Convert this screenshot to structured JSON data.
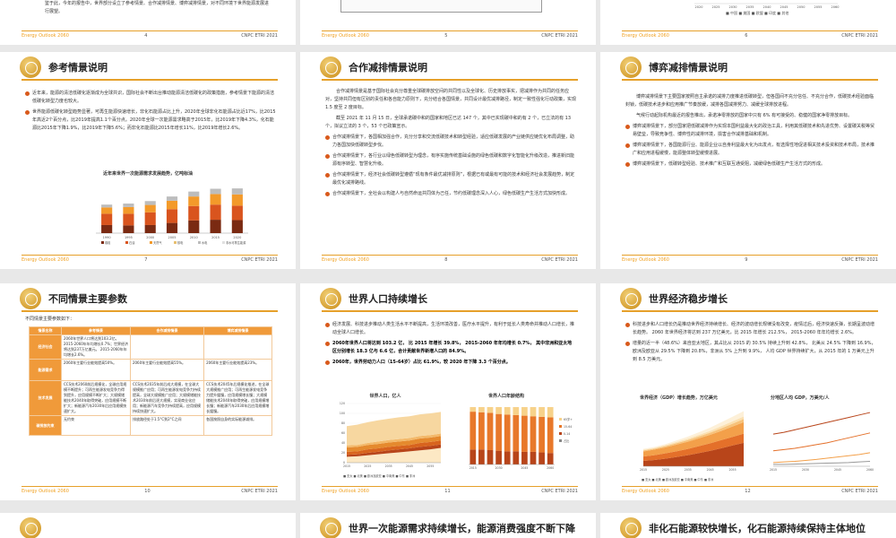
{
  "common": {
    "footer_left": "Energy Outlook 2060",
    "footer_right": "CNPC ETRI 2021"
  },
  "p4": {
    "text": "鉴于此，今年的报告中，世界部分设立了参考情景、合作减排情景、博弈减排情景，对不同环境下世界能源发展进行展望。",
    "page": "4"
  },
  "p5": {
    "page": "5"
  },
  "p6": {
    "page": "6",
    "ticks": [
      "2020",
      "2025",
      "2030",
      "2035",
      "2040",
      "2045",
      "2050",
      "2055",
      "2060"
    ],
    "legend": "■ 中国  ■ 美国  ■ 欧盟  ■ 印度  ■ 其他"
  },
  "p7": {
    "title": "参考情景说明",
    "b1": "近年来，能源的清洁低碳化逐渐成为全球共识，国际社会不断出台推动能源清洁低碳化的政策措施，参考情景下能源的清洁低碳化转型力度也较大。",
    "b2": "世界能源低碳化转型趋势显著，可再生能源快速增长，非化石能源占比上升，2020年全球非化石能源占比近17%，比2015年高近2个百分点，比2019年提高1.1个百分点。2020年全球一次能源需求略高于2015年，比2019年下降4.3%，化石能源比2015年下降1.9%，比2019年下降5.6%；而非化石能源比2015年增长11%，比2019年增长2.6%。",
    "chart_title": "近年来世界一次能源需求发展趋势，亿吨标油",
    "page": "7"
  },
  "p8": {
    "title": "合作减排情景说明",
    "para1": "合作减排情景是基于国际社会充分尊重全球碳排放空间的共同性以及全球化、历史排放事实，把减排作为共同的任务应对，坚持共同但有区别的责任和各自能力原则下，充分结合各国情景，共同设计最优减排路径，制定一致性强化行动政策，实现 1.5 度至 2 度目标。",
    "para2": "截至 2021 年 11 月 15 日，全球承诺碳中和的国家和地区已达 147 个，其中已实现碳中和的有 2 个，已立法的有 13 个，拟议立法的 3 个，53 个已政策宣示。",
    "b1": "合作减排情景下，各国相加强合作，充分分享和交流低碳技术和转型经验，适应低碳发展的产业链供应链优化布局调整，助力各国加快低碳转型步伐。",
    "b2": "合作减排情景下，各行业以绿色低碳转型为理念，有序实施传统基础设施的绿色低碳和数字化智能化升级改造，推进新旧能源有序转型、智慧化升级。",
    "b3": "合作减排情景下，经济社会低碳转型遵循“现有条件最优减排原则”，根据已有或最有可能的技术和经济社会发展趋势，制定最优化减排路线。",
    "b4": "合作减排情景下，全社会以构建人与自然命运共同体为己任，节约低碳理念深入人心，绿色低碳生产生活方式加快形成。",
    "page": "8"
  },
  "p9": {
    "title": "博弈减排情景说明",
    "para1": "博弈减排情景下主要国家按照自主承诺的减排力度推进低碳转型，但各国间不充分信任、不充分合作，低碳技术经验面临封锁，低碳技术进步和应用推广节奏放缓，减排各国减排努力、减缓全球排放进程。",
    "para2": "气候行动起际机构最近的报告推出，承诺净零排放的国家中只有 6% 有可接受的、稳健的国家净零排放目标。",
    "b1": "博弈减排情景下，部分国家把低碳减排作为实现本国利益最大化的政治工具，利用其低碳技术和先进优势、设置碳关税等贸易壁垒，导致竞争性、博弈性的减排环境，损害合作减排基础和机制。",
    "b2": "博弈减排情景下，各国能源行业、能源企业以自身利益最大化为出发点，有选择性地促进相关技术投资和技术布局，技术推广和应用进程缓慢，能源整体转型缓慢进展。",
    "b3": "博弈减排情景下，低碳转型经验、技术推广和互联互通受阻，减缓绿色低碳生产生活方式的形成。",
    "page": "9"
  },
  "p10": {
    "title": "不同情景主要参数",
    "subtitle": "不同情景主要参数如下：",
    "headers": [
      "情景名称",
      "参考情景",
      "合作减排情景",
      "博弈减排情景"
    ],
    "rows": [
      {
        "label": "经济社会",
        "c1": "2060年世界人口将达到103.2亿。 2015-2060年年均增长0.7%；世界经济将达到237万亿美元。 2015-2060年年均增长2.6%。",
        "c2": "",
        "c3": ""
      },
      {
        "label": "能源需求",
        "c1": "2060年主要行业能效提高50%。",
        "c2": "2060年主要行业能效提高55%。",
        "c3": "2060年主要行业能效提高23%。"
      },
      {
        "label": "技术发展",
        "c1": "CCS技术2060前后规模化，全球应用规模不断提升；可再生能源发电竞争力得到提升，应用规模不断扩大；大规模储能技术2040年取得突破，应用规模不断扩大；新能源汽车2030年后应用规模快速扩大。",
        "c2": "CCS技术2035年前后成大规模，在全球大规模推广应用；可再生能源发电竞争力持续提高，全球大规模推广应用；大规模储能技术2030年前后逐大规模，实现商业化应用；新能源汽车竞争力持续提高，应用规模持续快速扩大。",
        "c3": "CCS技术2045年后规模化推进，在全球大规模推广应用；可再生能源发电竞争力提升缓慢，应用规模增长慢；大规模储能技术2040年取得突破，应用规模增长慢；新能源汽车2030年后应用规模增长缓慢。"
      },
      {
        "label": "碳排放约束",
        "c1": "无约束",
        "c2": "排放路径处于1.5°C到2°C之间",
        "c3": "各国按照自身的实际能源减排。"
      }
    ],
    "page": "10"
  },
  "p11": {
    "title": "世界人口持续增长",
    "b1": "经济发展、科技进步推动人类生活水平不断提高，生活环境改善，医疗水平提升，有利于延长人类寿命并推动人口增长，推动全球人口增长。",
    "b2": "2060年世界人口将达到 103.2 亿， 比 2015 年增长 39.8%， 2015-2060 年年均增长 0.7%， 其中非洲和亚太地区分别增长 18.3 亿与 6.6 亿，合计贡献世界新增人口的 84.9%。",
    "b3": "2060年，世界劳动力人口（15-64岁）占比 61.9%，较 2020 年下降 3.3 个百分点。",
    "chart1_title": "世界人口，亿人",
    "chart2_title": "世界人口年龄结构",
    "legend1": "■ 亚太  ■ 北美  ■ 欧洲及欧亚  ■ 中南美  ■ 中东  ■ 非洲",
    "legend2": [
      "65岁+",
      "15-64",
      "0-14",
      "占比"
    ],
    "page": "11"
  },
  "p12": {
    "title": "世界经济稳步增长",
    "b1": "科技进步和人口增长仍是推动世界经济持续增长、经济的波动增长规律没有改变，疫情过后，经济快速反弹，长期呈波动增长趋势。 2060 年世界经济将达到 237 万亿美元，比 2015 年增长 212.5%， 2015-2060 年年均增长 2.6%。",
    "b2": "增量的近一半（48.6%）来自亚太地区，其占比从 2015 的 30.5% 持续上升到 42.8%， 北美从 24.5% 下降到 16.9%， 欧洲及欧亚从 29.5% 下降到 20.8%，非洲从 5% 上升到 9.9%， 人均 GDP 世界持续扩大，从 2015 年的 1 万美元上升到 8.5 万美元。",
    "chart1_title": "世界经济（GDP）增长趋势，万亿美元",
    "chart2_title": "分地区人均 GDP，万美元/人",
    "legend1": "■ 亚太  ■ 北美  ■ 欧洲及欧亚  ■ 中南美  ■ 中东  ■ 非洲",
    "page": "12"
  },
  "p13": {
    "title": ""
  },
  "p14": {
    "title": "世界一次能源需求持续增长，能源消费强度不断下降"
  },
  "p15": {
    "title": "非化石能源较快增长，化石能源持续保持主体地位"
  },
  "chart_data": [
    {
      "type": "bar",
      "title": "近年来世界一次能源需求发展趋势，亿吨标油",
      "categories": [
        "1990",
        "1995",
        "2000",
        "2005",
        "2010",
        "2015",
        "2020"
      ],
      "series": [
        {
          "name": "煤炭",
          "values": [
            23,
            22,
            23,
            29,
            36,
            38,
            37
          ]
        },
        {
          "name": "石油",
          "values": [
            32,
            33,
            36,
            39,
            41,
            43,
            41
          ]
        },
        {
          "name": "天然气",
          "values": [
            18,
            19,
            21,
            24,
            27,
            30,
            32
          ]
        },
        {
          "name": "非化石",
          "values": [
            8,
            10,
            11,
            12,
            14,
            15,
            17
          ]
        }
      ],
      "legend": [
        "煤炭",
        "石油",
        "天然气",
        "核电",
        "水电",
        "非水可再生能源"
      ]
    },
    {
      "type": "area",
      "title": "世界人口，亿人",
      "x": [
        "2015",
        "2020",
        "2025",
        "2030",
        "2035",
        "2040",
        "2045",
        "2050",
        "2055",
        "2060"
      ],
      "ylim": [
        0,
        120
      ],
      "ticks": [
        "0",
        "20",
        "40",
        "60",
        "80",
        "100",
        "120"
      ],
      "series": [
        {
          "name": "非洲",
          "values": [
            12,
            13,
            15,
            17,
            19,
            21,
            23,
            25,
            27,
            30
          ]
        },
        {
          "name": "中东",
          "values": [
            4,
            4,
            5,
            5,
            6,
            6,
            6,
            7,
            7,
            7
          ]
        },
        {
          "name": "中南美",
          "values": [
            6,
            6,
            7,
            7,
            7,
            7,
            7,
            8,
            8,
            8
          ]
        },
        {
          "name": "欧洲及欧亚",
          "values": [
            9,
            9,
            9,
            9,
            9,
            9,
            9,
            9,
            9,
            9
          ]
        },
        {
          "name": "北美",
          "values": [
            4,
            4,
            4,
            5,
            5,
            5,
            5,
            5,
            5,
            5
          ]
        },
        {
          "name": "亚太",
          "values": [
            39,
            41,
            42,
            43,
            43,
            44,
            44,
            44,
            44,
            44
          ]
        }
      ]
    },
    {
      "type": "bar",
      "title": "世界人口年龄结构",
      "categories": [
        "2015",
        "2020",
        "2025",
        "2030",
        "2035",
        "2040",
        "2045",
        "2050",
        "2055",
        "2060"
      ],
      "series": [
        {
          "name": "65岁+",
          "values": [
            8,
            9,
            10,
            12,
            13,
            14,
            15,
            16,
            17,
            18
          ]
        },
        {
          "name": "15-64",
          "values": [
            66,
            65,
            65,
            64,
            64,
            63,
            63,
            62,
            62,
            62
          ]
        },
        {
          "name": "0-14",
          "values": [
            26,
            26,
            25,
            24,
            23,
            23,
            22,
            22,
            21,
            20
          ]
        }
      ],
      "ylim": [
        0,
        100
      ]
    },
    {
      "type": "area",
      "title": "世界经济（GDP）增长趋势，万亿美元",
      "x": [
        "2015",
        "2020",
        "2025",
        "2030",
        "2035",
        "2040",
        "2045",
        "2050",
        "2055",
        "2060"
      ],
      "series": [
        {
          "name": "亚太",
          "values": [
            23,
            27,
            33,
            40,
            48,
            57,
            67,
            78,
            90,
            101
          ]
        },
        {
          "name": "北美",
          "values": [
            19,
            21,
            23,
            25,
            27,
            30,
            32,
            35,
            37,
            40
          ]
        },
        {
          "name": "欧洲及欧亚",
          "values": [
            22,
            24,
            26,
            29,
            31,
            34,
            37,
            40,
            45,
            49
          ]
        },
        {
          "name": "中南美",
          "values": [
            4,
            4,
            5,
            6,
            7,
            8,
            9,
            11,
            12,
            14
          ]
        },
        {
          "name": "中东",
          "values": [
            3,
            3,
            4,
            5,
            6,
            7,
            8,
            9,
            10,
            11
          ]
        },
        {
          "name": "非洲",
          "values": [
            4,
            4,
            5,
            7,
            9,
            11,
            14,
            17,
            20,
            23
          ]
        }
      ]
    },
    {
      "type": "line",
      "title": "分地区人均 GDP，万美元/人",
      "x": [
        "2015",
        "2020",
        "2025",
        "2030",
        "2035",
        "2040",
        "2045",
        "2050",
        "2055",
        "2060"
      ],
      "series": [
        {
          "name": "北美",
          "values": [
            5.2,
            5.5,
            5.9,
            6.3,
            6.7,
            7.1,
            7.5,
            7.9,
            8.3,
            8.7
          ]
        },
        {
          "name": "欧洲及欧亚",
          "values": [
            2.5,
            2.7,
            2.9,
            3.2,
            3.5,
            3.8,
            4.2,
            4.6,
            5.0,
            5.4
          ]
        },
        {
          "name": "亚太",
          "values": [
            0.6,
            0.7,
            0.8,
            0.95,
            1.1,
            1.3,
            1.5,
            1.7,
            1.9,
            2.2
          ]
        },
        {
          "name": "非洲",
          "values": [
            0.3,
            0.3,
            0.35,
            0.4,
            0.45,
            0.5,
            0.55,
            0.6,
            0.7,
            0.8
          ]
        }
      ]
    }
  ]
}
